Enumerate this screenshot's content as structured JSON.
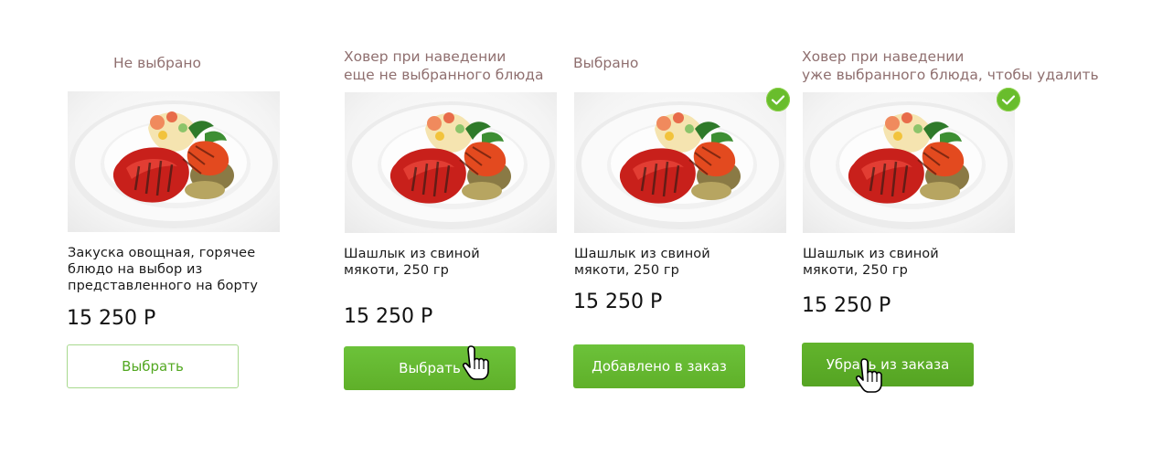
{
  "colors": {
    "accent": "#69bd2c",
    "label": "#8f6f6f"
  },
  "cards": [
    {
      "state_lines": [
        "Не выбрано"
      ],
      "title_lines": [
        "Закуска овощная, горячее",
        "блюдо на выбор из",
        "представленного на борту"
      ],
      "price": "15 250 Р",
      "button": "Выбрать",
      "selected": false
    },
    {
      "state_lines": [
        "Ховер при наведении",
        "еще не выбранного блюда"
      ],
      "title_lines": [
        "Шашлык из свиной",
        "мякоти, 250 гр"
      ],
      "price": "15 250 Р",
      "button": "Выбрать",
      "selected": false
    },
    {
      "state_lines": [
        "Выбрано"
      ],
      "title_lines": [
        "Шашлык из свиной",
        "мякоти, 250 гр"
      ],
      "price": "15 250 Р",
      "button": "Добавлено в заказ",
      "selected": true
    },
    {
      "state_lines": [
        "Ховер при наведении",
        "уже выбранного блюда, чтобы удалить"
      ],
      "title_lines": [
        "Шашлык из свиной",
        "мякоти, 250 гр"
      ],
      "price": "15 250 Р",
      "button": "Убрать из заказа",
      "selected": true
    }
  ]
}
